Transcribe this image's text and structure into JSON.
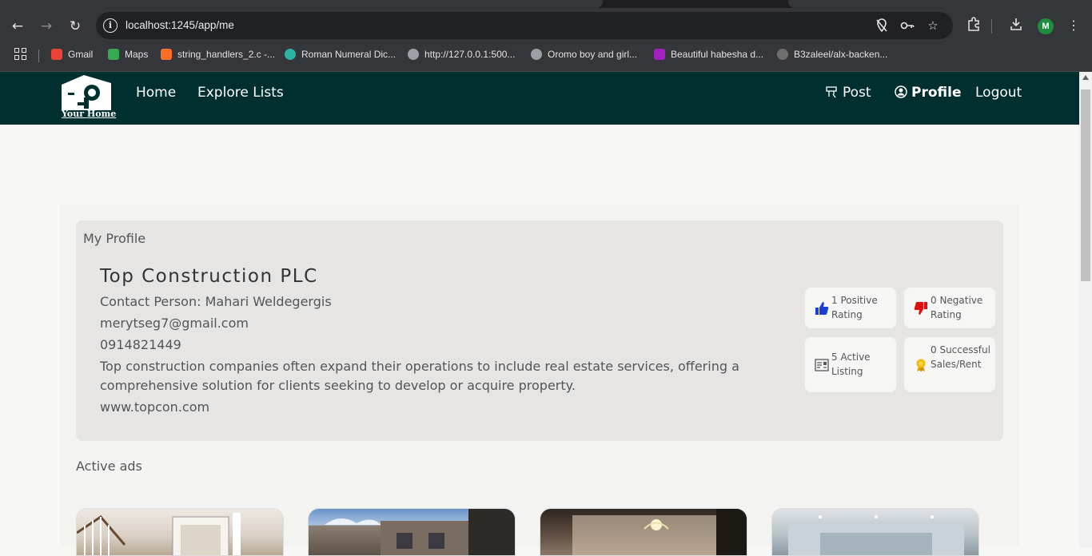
{
  "browser": {
    "url": "localhost:1245/app/me",
    "profile_initial": "M",
    "bookmarks": [
      {
        "label": "Gmail",
        "color": "#ea4335"
      },
      {
        "label": "Maps",
        "color": "#34a853"
      },
      {
        "label": "string_handlers_2.c -...",
        "color": "#fc6d26"
      },
      {
        "label": "Roman Numeral Dic...",
        "color": "#2bb3a3"
      },
      {
        "label": "http://127.0.0.1:500...",
        "color": "#9aa0a6"
      },
      {
        "label": "Oromo boy and girl...",
        "color": "#9aa0a6"
      },
      {
        "label": "Beautiful habesha d...",
        "color": "#a020c0"
      },
      {
        "label": "B3zaleel/alx-backen...",
        "color": "#6e6e6e"
      }
    ]
  },
  "site": {
    "brand": "Your Home",
    "nav_left": [
      "Home",
      "Explore Lists"
    ],
    "nav_right": {
      "post": "Post",
      "profile": "Profile",
      "logout": "Logout"
    },
    "nav_bg": "#002f2f"
  },
  "profile": {
    "heading": "My Profile",
    "company": "Top Construction PLC",
    "contact": "Contact Person: Mahari Weldegergis",
    "email": "merytseg7@gmail.com",
    "phone": "0914821449",
    "description": "Top construction companies often expand their operations to include real estate services, offering a comprehensive solution for clients seeking to develop or acquire property.",
    "website": "www.topcon.com"
  },
  "stats": {
    "positive": "1 Positive Rating",
    "negative": "0 Negative Rating",
    "active": "5 Active Listing",
    "sales": "0 Successful Sales/Rent"
  },
  "active_ads": {
    "title": "Active ads"
  }
}
